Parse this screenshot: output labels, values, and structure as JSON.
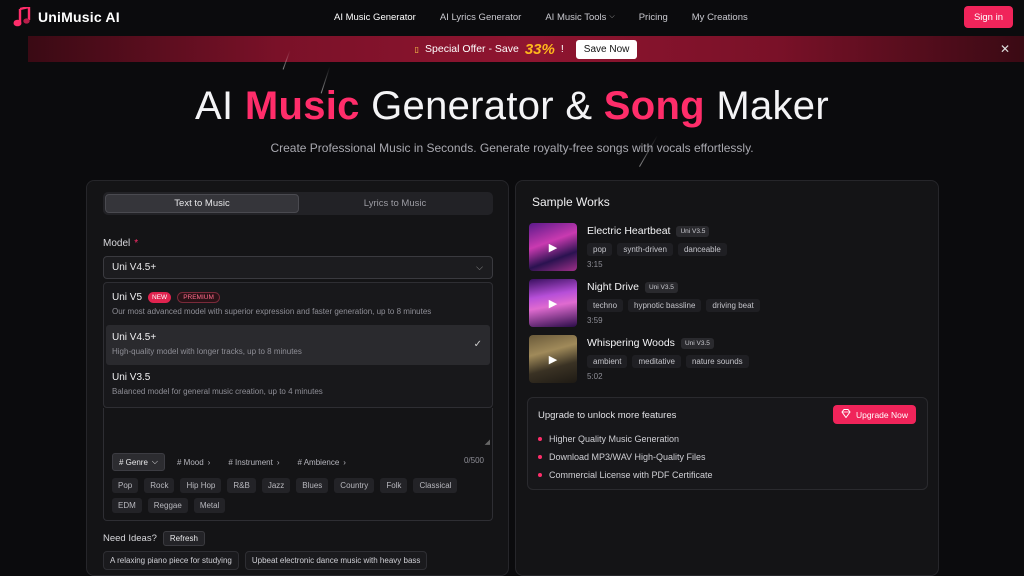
{
  "header": {
    "brand": "UniMusic AI",
    "signin": "Sign in",
    "nav": [
      {
        "label": "AI Music Generator",
        "dropdown": false
      },
      {
        "label": "AI Lyrics Generator",
        "dropdown": false
      },
      {
        "label": "AI Music Tools",
        "dropdown": true
      },
      {
        "label": "Pricing",
        "dropdown": false
      },
      {
        "label": "My Creations",
        "dropdown": false
      }
    ]
  },
  "promo": {
    "text": "Special Offer - Save",
    "percent": "33%",
    "excl": "!",
    "button": "Save Now",
    "close": "✕"
  },
  "hero": {
    "t1": "AI ",
    "t2": "Music",
    "t3": " Generator & ",
    "t4": "Song",
    "t5": " Maker",
    "subtitle": "Create Professional Music in Seconds. Generate royalty-free songs with vocals effortlessly."
  },
  "form": {
    "tabs": [
      "Text to Music",
      "Lyrics to Music"
    ],
    "model_label": "Model",
    "required": "*",
    "selected_model": "Uni V4.5+",
    "models": [
      {
        "name": "Uni V5",
        "badge_new": "NEW",
        "badge_premium": "PREMIUM",
        "desc": "Our most advanced model with superior expression and faster generation, up to 8 minutes"
      },
      {
        "name": "Uni V4.5+",
        "desc": "High-quality model with longer tracks, up to 8 minutes"
      },
      {
        "name": "Uni V3.5",
        "desc": "Balanced model for general music creation, up to 4 minutes"
      }
    ],
    "filters": [
      "# Genre",
      "# Mood",
      "# Instrument",
      "# Ambience"
    ],
    "counter": "0/500",
    "genres_row1": [
      "Pop",
      "Rock",
      "Hip Hop",
      "R&B",
      "Jazz",
      "Blues",
      "Country",
      "Folk",
      "Classical"
    ],
    "genres_row2": [
      "EDM",
      "Reggae",
      "Metal"
    ],
    "ideas_label": "Need Ideas?",
    "refresh": "Refresh",
    "ideas": [
      "A relaxing piano piece for studying",
      "Upbeat electronic dance music with heavy bass"
    ]
  },
  "samples": {
    "title": "Sample Works",
    "tracks": [
      {
        "title": "Electric Heartbeat",
        "version": "Uni V3.5",
        "tags": [
          "pop",
          "synth-driven",
          "danceable"
        ],
        "duration": "3:15"
      },
      {
        "title": "Night Drive",
        "version": "Uni V3.5",
        "tags": [
          "techno",
          "hypnotic bassline",
          "driving beat"
        ],
        "duration": "3:59"
      },
      {
        "title": "Whispering Woods",
        "version": "Uni V3.5",
        "tags": [
          "ambient",
          "meditative",
          "nature sounds"
        ],
        "duration": "5:02"
      }
    ]
  },
  "upgrade": {
    "title": "Upgrade to unlock more features",
    "button": "Upgrade Now",
    "features": [
      "Higher Quality Music Generation",
      "Download MP3/WAV High-Quality Files",
      "Commercial License with PDF Certificate"
    ]
  },
  "colors": {
    "accent": "#ff2d6a",
    "button": "#f0245a",
    "background": "#0b0b0d"
  }
}
